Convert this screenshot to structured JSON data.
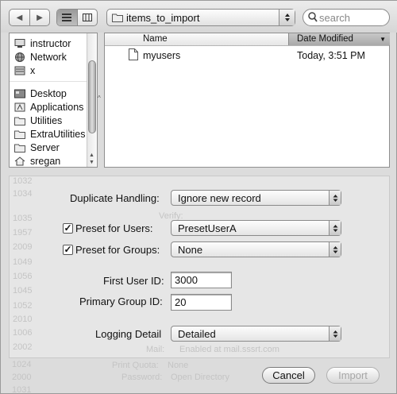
{
  "toolbar": {
    "back_glyph": "◀",
    "forward_glyph": "▶",
    "location": "items_to_import",
    "search_placeholder": "search"
  },
  "sidebar": {
    "items": [
      {
        "label": "instructor",
        "icon": "computer-icon"
      },
      {
        "label": "Network",
        "icon": "globe-icon"
      },
      {
        "label": "x",
        "icon": "drive-icon"
      },
      {
        "label": "Desktop",
        "icon": "desktop-icon"
      },
      {
        "label": "Applications",
        "icon": "applications-icon"
      },
      {
        "label": "Utilities",
        "icon": "folder-icon"
      },
      {
        "label": "ExtraUtilities",
        "icon": "folder-icon"
      },
      {
        "label": "Server",
        "icon": "folder-icon"
      },
      {
        "label": "sregan",
        "icon": "home-icon"
      }
    ]
  },
  "filelist": {
    "col_name": "Name",
    "col_modified": "Date Modified",
    "rows": [
      {
        "name": "myusers",
        "modified": "Today, 3:51 PM"
      }
    ]
  },
  "options": {
    "duplicate_label": "Duplicate Handling:",
    "duplicate_value": "Ignore new record",
    "preset_users_label": "Preset for Users:",
    "preset_users_checked": true,
    "preset_users_value": "PresetUserA",
    "preset_groups_label": "Preset for Groups:",
    "preset_groups_checked": true,
    "preset_groups_value": "None",
    "first_user_id_label": "First User ID:",
    "first_user_id_value": "3000",
    "primary_group_label": "Primary Group ID:",
    "primary_group_value": "20",
    "logging_label": "Logging Detail",
    "logging_value": "Detailed"
  },
  "background_text": [
    "1032",
    "1034",
    "1035",
    "1957",
    "2009",
    "1049",
    "1056",
    "1045",
    "1052",
    "2010",
    "1006",
    "2002",
    "1024",
    "2000",
    "1031",
    "Verify:",
    "Mail:",
    "Enabled at mail.sssrt.com",
    "Print Quota:",
    "None",
    "Password:",
    "Open Directory"
  ],
  "buttons": {
    "cancel": "Cancel",
    "import": "Import"
  }
}
